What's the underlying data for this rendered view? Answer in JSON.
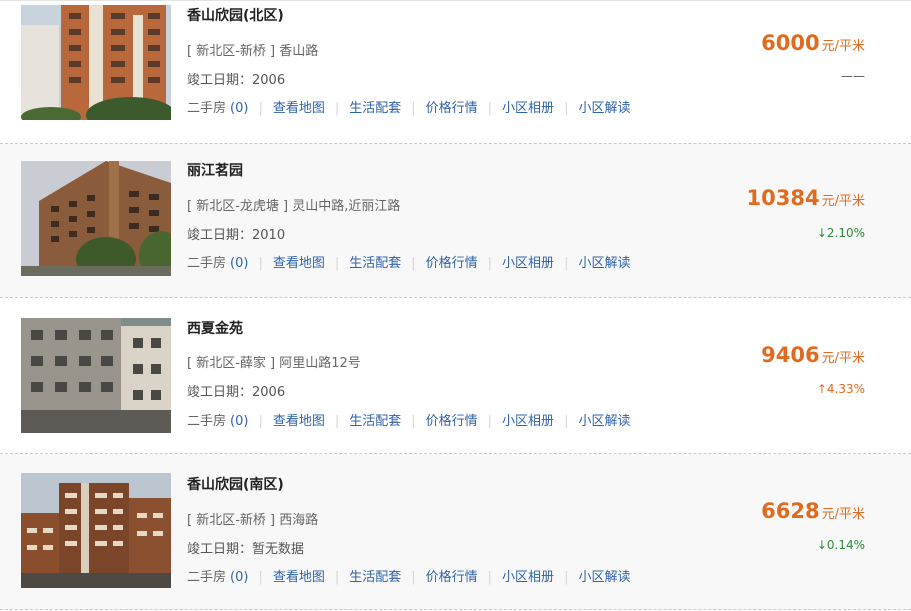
{
  "listings": [
    {
      "name": "香山欣园(北区)",
      "address": "[ 新北区-新桥 ] 香山路",
      "completion": "竣工日期：2006",
      "price": "6000",
      "price_unit": "元/平米",
      "change": "——",
      "change_dir": "none",
      "links": {
        "second_hand": "二手房",
        "second_hand_count": "(0)",
        "map": "查看地图",
        "amenities": "生活配套",
        "market": "价格行情",
        "album": "小区相册",
        "review": "小区解读"
      }
    },
    {
      "name": "丽江茗园",
      "address": "[ 新北区-龙虎塘 ] 灵山中路,近丽江路",
      "completion": "竣工日期：2010",
      "price": "10384",
      "price_unit": "元/平米",
      "change": "↓2.10%",
      "change_dir": "down",
      "links": {
        "second_hand": "二手房",
        "second_hand_count": "(0)",
        "map": "查看地图",
        "amenities": "生活配套",
        "market": "价格行情",
        "album": "小区相册",
        "review": "小区解读"
      }
    },
    {
      "name": "西夏金苑",
      "address": "[ 新北区-薛家 ] 阿里山路12号",
      "completion": "竣工日期：2006",
      "price": "9406",
      "price_unit": "元/平米",
      "change": "↑4.33%",
      "change_dir": "up",
      "links": {
        "second_hand": "二手房",
        "second_hand_count": "(0)",
        "map": "查看地图",
        "amenities": "生活配套",
        "market": "价格行情",
        "album": "小区相册",
        "review": "小区解读"
      }
    },
    {
      "name": "香山欣园(南区)",
      "address": "[ 新北区-新桥 ] 西海路",
      "completion": "竣工日期：暂无数据",
      "price": "6628",
      "price_unit": "元/平米",
      "change": "↓0.14%",
      "change_dir": "down",
      "links": {
        "second_hand": "二手房",
        "second_hand_count": "(0)",
        "map": "查看地图",
        "amenities": "生活配套",
        "market": "价格行情",
        "album": "小区相册",
        "review": "小区解读"
      }
    }
  ],
  "colors": {
    "price": "#e06b1e",
    "link": "#2f63a8",
    "down": "#2f8a3a",
    "up": "#e06b1e"
  }
}
